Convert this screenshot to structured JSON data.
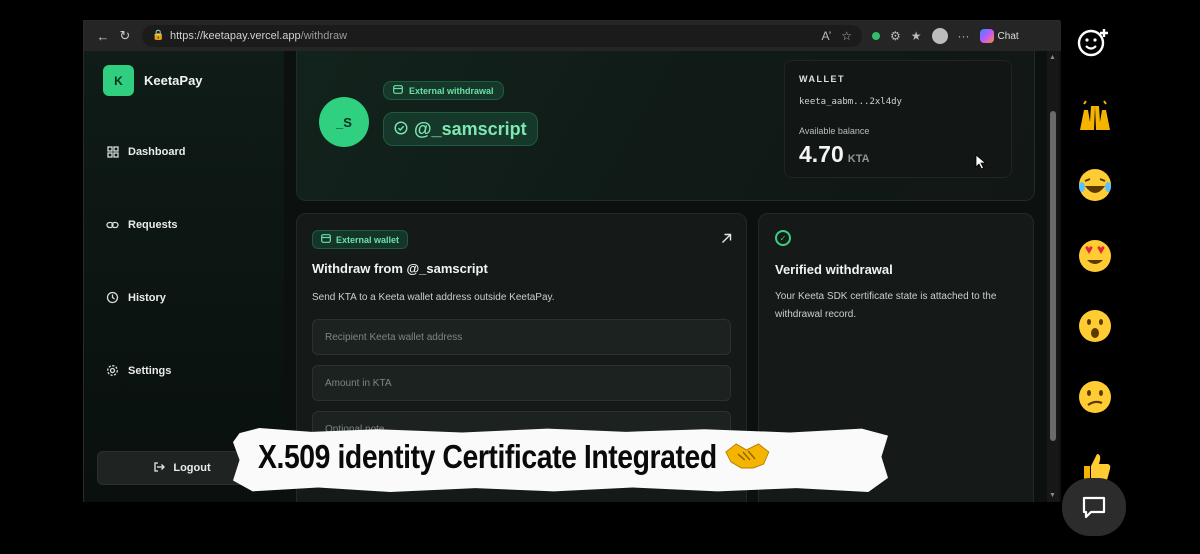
{
  "browser": {
    "url_host": "https://keetapay.vercel.app",
    "url_path": "/withdraw",
    "chat_label": "Chat"
  },
  "sidebar": {
    "brand_mark": "K",
    "brand_name": "KeetaPay",
    "items": [
      {
        "label": "Dashboard",
        "icon": "grid-icon"
      },
      {
        "label": "Requests",
        "icon": "link-icon"
      },
      {
        "label": "History",
        "icon": "history-icon"
      },
      {
        "label": "Settings",
        "icon": "gear-icon"
      }
    ],
    "logout_label": "Logout"
  },
  "hero": {
    "avatar_initials": "_S",
    "badge_label": "External withdrawal",
    "handle": "@_samscript"
  },
  "wallet": {
    "title": "WALLET",
    "address": "keeta_aabm...2xl4dy",
    "balance_label": "Available balance",
    "balance": "4.70",
    "unit": "KTA"
  },
  "withdraw_card": {
    "tag": "External wallet",
    "title": "Withdraw from @_samscript",
    "description": "Send KTA to a Keeta wallet address outside KeetaPay.",
    "recipient_placeholder": "Recipient Keeta wallet address",
    "amount_placeholder": "Amount in KTA",
    "note_placeholder": "Optional note"
  },
  "verified_card": {
    "title": "Verified withdrawal",
    "description": "Your Keeta SDK certificate state is attached to the withdrawal record."
  },
  "caption": {
    "text": "X.509 identity Certificate Integrated"
  },
  "colors": {
    "accent": "#2fcf7f",
    "background": "#0c1110",
    "card": "#151a18"
  }
}
